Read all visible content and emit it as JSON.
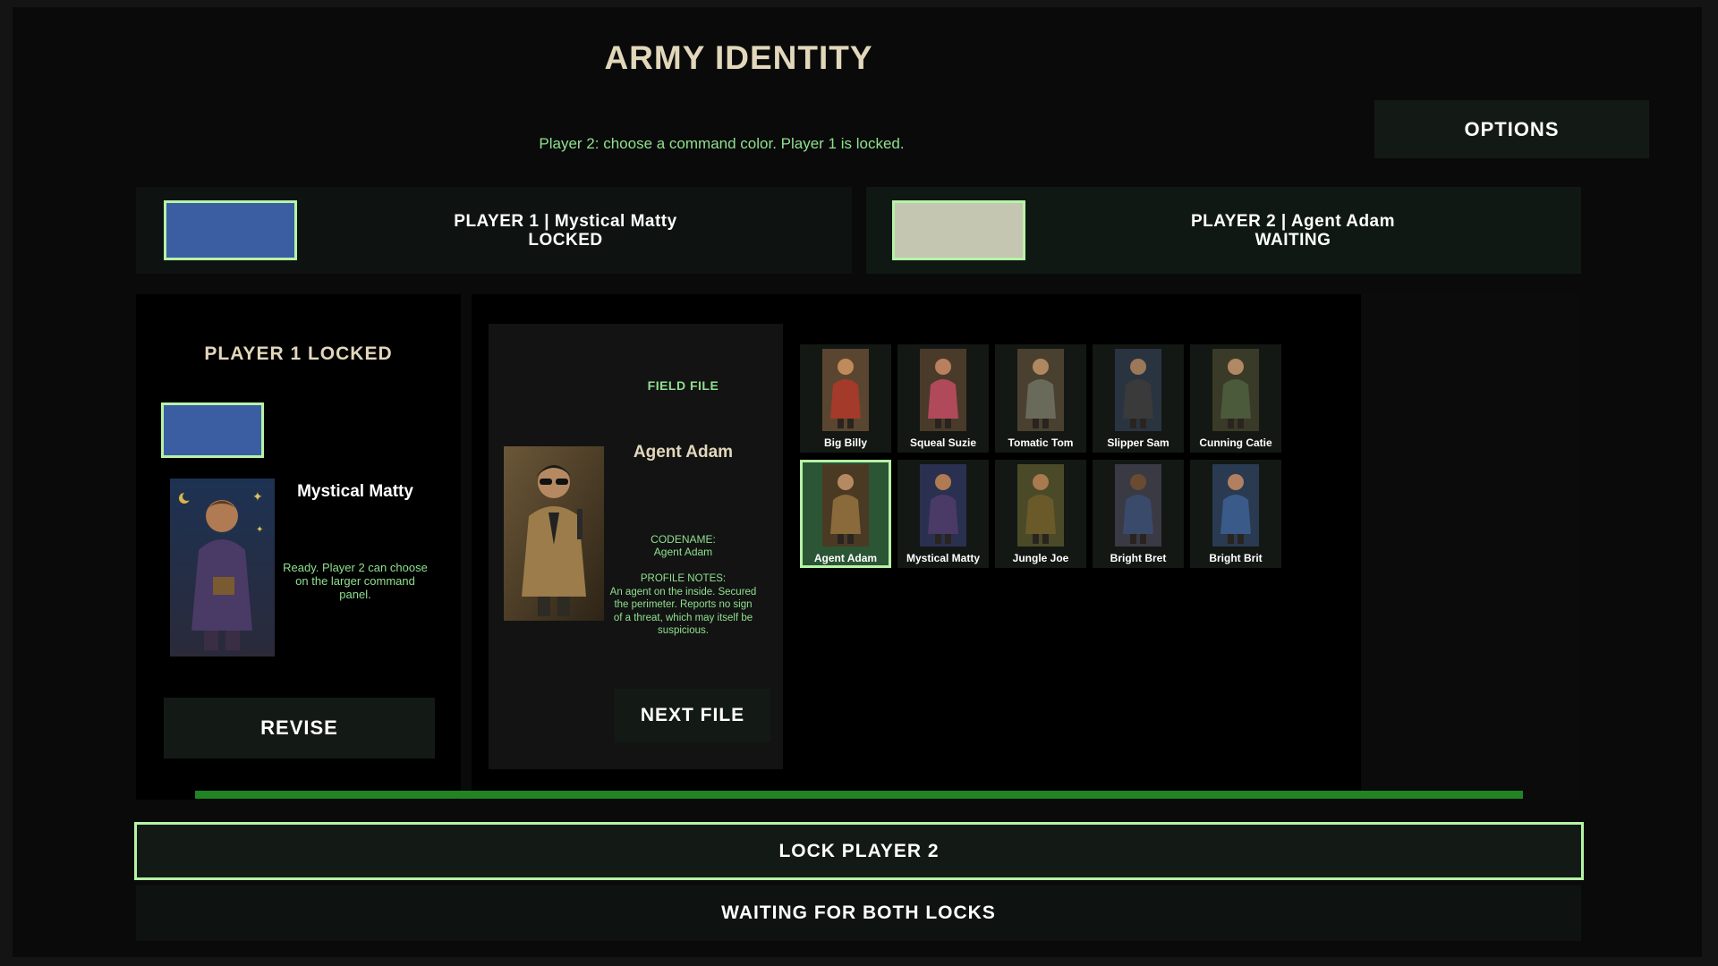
{
  "header": {
    "title": "ARMY IDENTITY",
    "hint": "Player 2: choose a command color. Player 1 is locked.",
    "options_label": "OPTIONS"
  },
  "colors": {
    "player1": "#3a5ea1",
    "player2": "#c4c6b1",
    "accent": "#b6f3a6",
    "hint_text": "#8fe08f",
    "progress": "#218323"
  },
  "player1": {
    "bar_line1": "PLAYER 1 | Mystical Matty",
    "bar_line2": "LOCKED",
    "panel_heading": "PLAYER 1 LOCKED",
    "character": "Mystical Matty",
    "note": "Ready. Player 2 can choose on the larger command panel.",
    "revise_label": "REVISE"
  },
  "player2": {
    "bar_line1": "PLAYER 2 | Agent Adam",
    "bar_line2": "WAITING"
  },
  "field_file": {
    "label": "FIELD FILE",
    "name": "Agent Adam",
    "codename_label": "CODENAME:",
    "codename": "Agent Adam",
    "notes_label": "PROFILE NOTES:",
    "notes": "An agent on the inside. Secured the perimeter. Reports no sign of a threat, which may itself be suspicious.",
    "next_label": "NEXT FILE"
  },
  "roster": [
    {
      "name": "Big Billy"
    },
    {
      "name": "Squeal Suzie"
    },
    {
      "name": "Tomatic Tom"
    },
    {
      "name": "Slipper Sam"
    },
    {
      "name": "Cunning Catie"
    },
    {
      "name": "Agent Adam",
      "selected": true
    },
    {
      "name": "Mystical Matty"
    },
    {
      "name": "Jungle Joe"
    },
    {
      "name": "Bright Bret"
    },
    {
      "name": "Bright Brit"
    }
  ],
  "footer": {
    "lock_label": "LOCK PLAYER 2",
    "status": "WAITING FOR BOTH LOCKS"
  }
}
